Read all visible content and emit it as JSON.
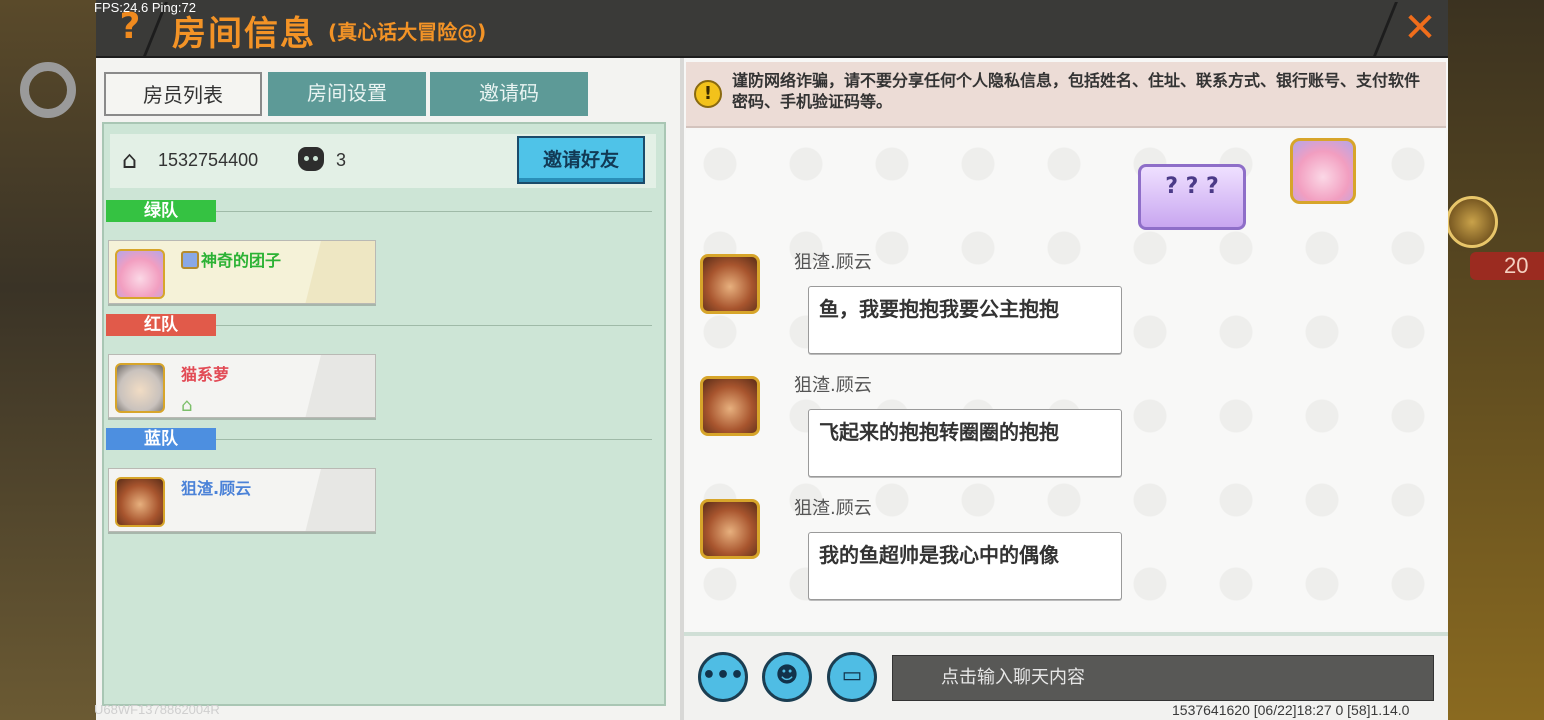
{
  "status": {
    "fps": "FPS:24.6",
    "ping": "Ping:72"
  },
  "header": {
    "help_icon": "question-mark-icon",
    "help_glyph": "?",
    "title": "房间信息",
    "subtitle": "(真心话大冒险@)",
    "close_glyph": "✕"
  },
  "tabs": [
    {
      "label": "房员列表",
      "active": true
    },
    {
      "label": "房间设置",
      "active": false
    },
    {
      "label": "邀请码",
      "active": false
    }
  ],
  "room": {
    "id": "1532754400",
    "player_count": "3",
    "invite_button": "邀请好友"
  },
  "teams": [
    {
      "name": "绿队",
      "color": "#35c242",
      "members": [
        {
          "name": "神奇的团子"
        }
      ]
    },
    {
      "name": "红队",
      "color": "#e15a4a",
      "members": [
        {
          "name": "猫系萝"
        }
      ]
    },
    {
      "name": "蓝队",
      "color": "#4d8fe0",
      "members": [
        {
          "name": "狙渣.顾云"
        }
      ]
    }
  ],
  "chat": {
    "warning_glyph": "!",
    "warning": "谨防网络诈骗，请不要分享任何个人隐私信息，包括姓名、住址、联系方式、银行账号、支付软件密码、手机验证码等。",
    "emote_text": "? ? ?",
    "messages": [
      {
        "sender": "狙渣.顾云",
        "text": "鱼，我要抱抱我要公主抱抱"
      },
      {
        "sender": "狙渣.顾云",
        "text": "飞起来的抱抱转圈圈的抱抱"
      },
      {
        "sender": "狙渣.顾云",
        "text": "我的鱼超帅是我心中的偶像"
      }
    ],
    "input_placeholder": "点击输入聊天内容",
    "more_glyph": "•••",
    "emoji_glyph": "☻",
    "keyboard_glyph": "▭"
  },
  "footer": {
    "left": "U68WF1378862004R",
    "right": "1537641620   [06/22]18:27 0   [58]1.14.0"
  },
  "background": {
    "right_text": "20"
  }
}
